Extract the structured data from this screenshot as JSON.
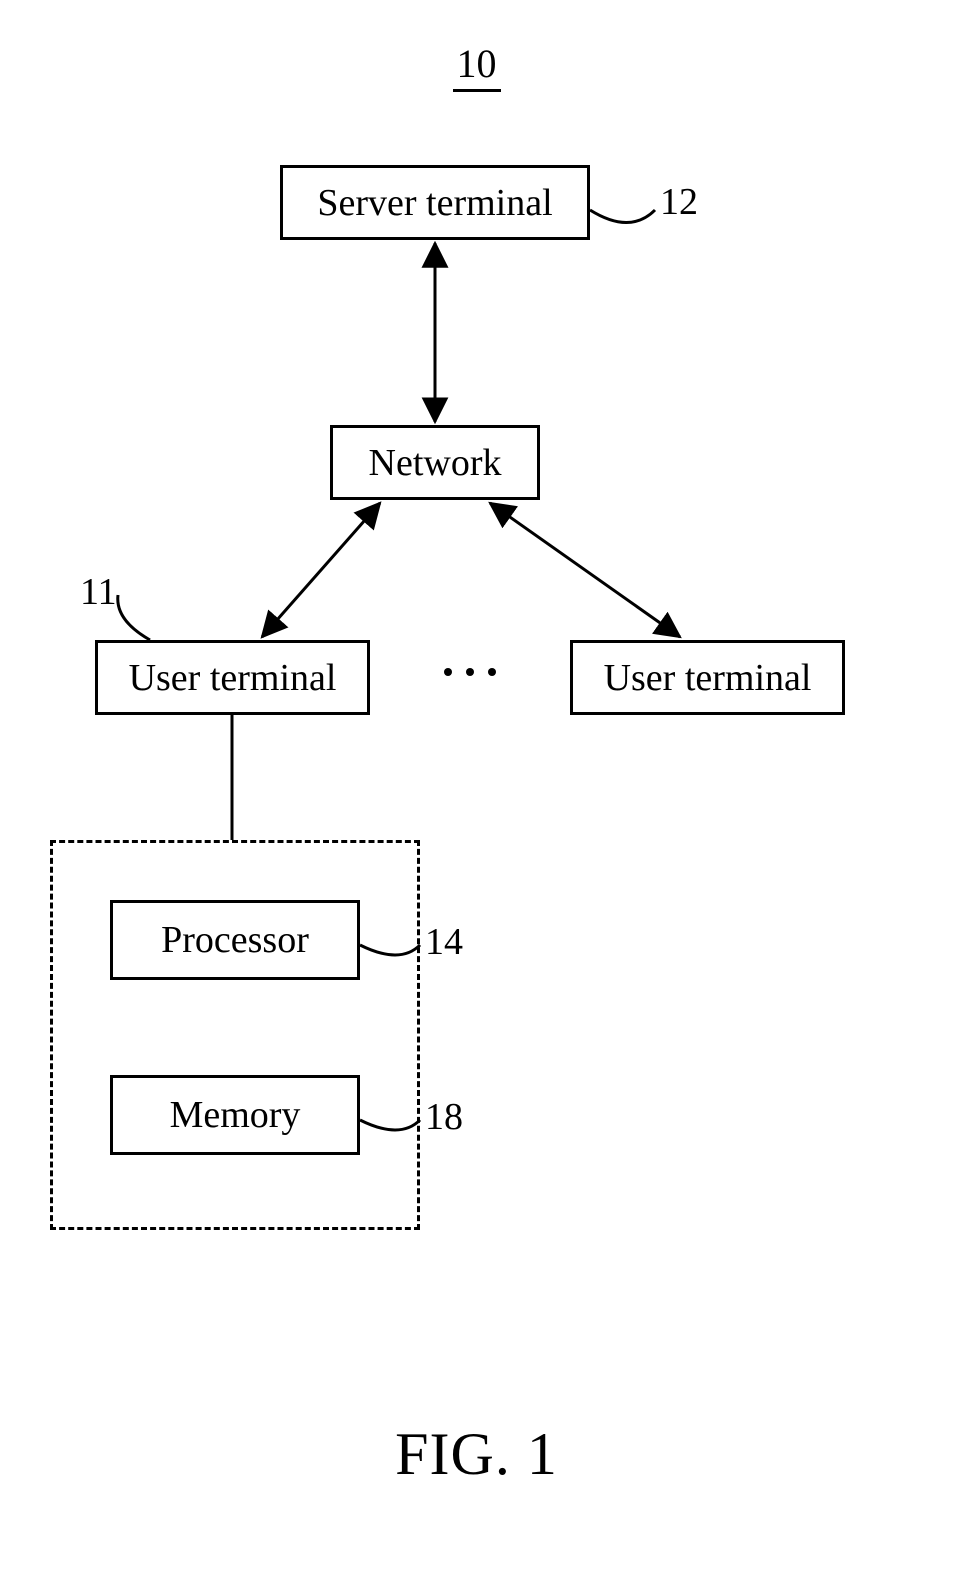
{
  "figure": {
    "ref_number": "10",
    "title": "FIG. 1"
  },
  "nodes": {
    "server_terminal": {
      "label": "Server terminal",
      "ref": "12"
    },
    "network": {
      "label": "Network"
    },
    "user_terminal_left": {
      "label": "User terminal",
      "ref": "11"
    },
    "user_terminal_right": {
      "label": "User terminal"
    },
    "processor": {
      "label": "Processor",
      "ref": "14"
    },
    "memory": {
      "label": "Memory",
      "ref": "18"
    }
  },
  "connections": [
    {
      "from": "server_terminal",
      "to": "network",
      "bidirectional": true
    },
    {
      "from": "network",
      "to": "user_terminal_left",
      "bidirectional": true
    },
    {
      "from": "network",
      "to": "user_terminal_right",
      "bidirectional": true
    },
    {
      "from": "user_terminal_left",
      "to": "detail_group",
      "bidirectional": false
    }
  ],
  "detail_group": {
    "contains": [
      "processor",
      "memory"
    ]
  }
}
